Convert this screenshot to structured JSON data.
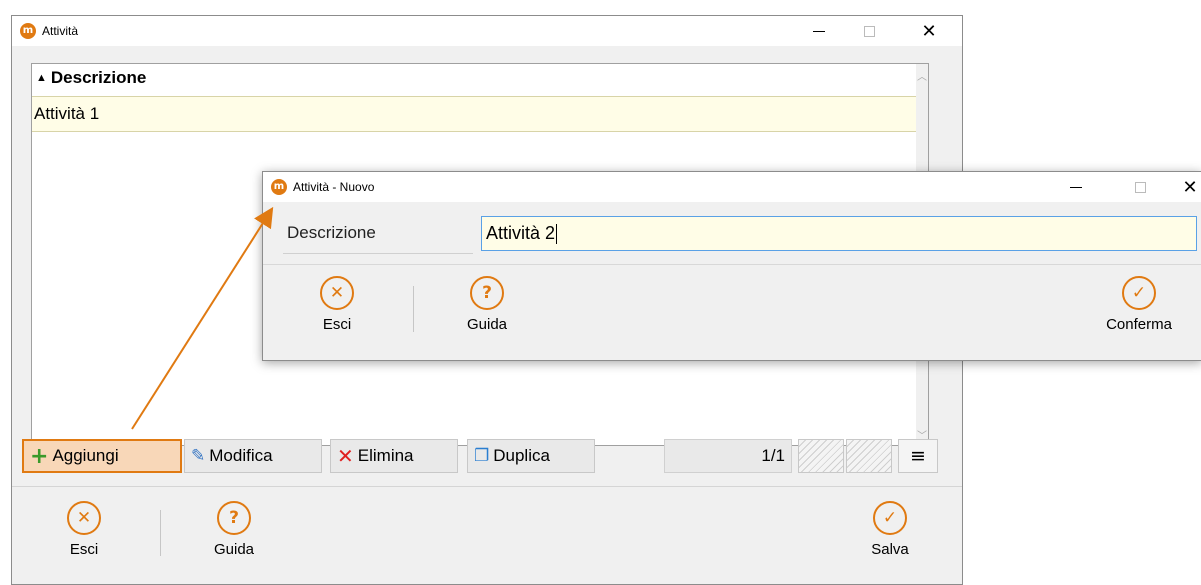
{
  "main_window": {
    "title": "Attività",
    "app_icon": "m",
    "grid": {
      "column_header": "Descrizione",
      "rows": [
        {
          "descrizione": "Attività 1"
        }
      ]
    },
    "toolbar": {
      "add_label": "Aggiungi",
      "edit_label": "Modifica",
      "delete_label": "Elimina",
      "duplicate_label": "Duplica",
      "pager": "1/1",
      "menu_icon": "≡"
    },
    "footer": {
      "exit_label": "Esci",
      "help_label": "Guida",
      "save_label": "Salva"
    }
  },
  "dialog": {
    "title": "Attività - Nuovo",
    "field_label": "Descrizione",
    "field_value": "Attività 2",
    "exit_label": "Esci",
    "help_label": "Guida",
    "confirm_label": "Conferma"
  },
  "colors": {
    "accent": "#e07a12",
    "row_highlight": "#fffde7",
    "input_focus": "#5aa1e6"
  },
  "icons": {
    "app": "app-logo-icon",
    "minimize": "minimize-icon",
    "maximize": "maximize-icon",
    "close": "close-icon",
    "add": "plus-icon",
    "edit": "edit-icon",
    "delete": "x-icon",
    "duplicate": "copy-icon",
    "exit": "circle-x-icon",
    "help": "circle-question-icon",
    "confirm": "circle-check-icon",
    "menu": "menu-icon"
  }
}
